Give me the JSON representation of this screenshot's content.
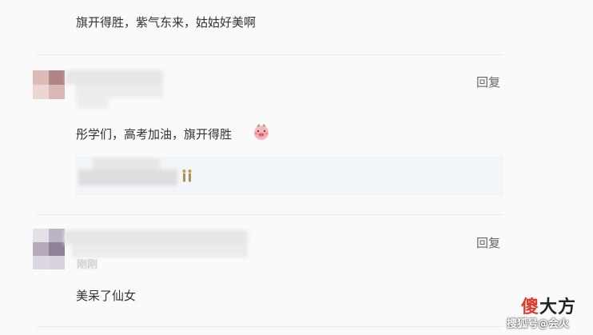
{
  "comment_top": {
    "text": "旗开得胜，紫气东来，姑姑好美啊"
  },
  "comment_1": {
    "reply_label": "回复",
    "text": "彤学们，高考加油，旗开得胜",
    "emoji": "pig-face-emoji",
    "quote_emoji": "two-people-emoji"
  },
  "comment_2": {
    "reply_label": "回复",
    "time_partial": "刚刚",
    "text": "美呆了仙女"
  },
  "watermark": {
    "brand_accent": "傻",
    "brand_rest": "大方",
    "source": "搜狐号@会火"
  },
  "colors": {
    "accent": "#e03a2a",
    "divider": "#ebebeb",
    "quote_bg": "#f3f6f9"
  }
}
